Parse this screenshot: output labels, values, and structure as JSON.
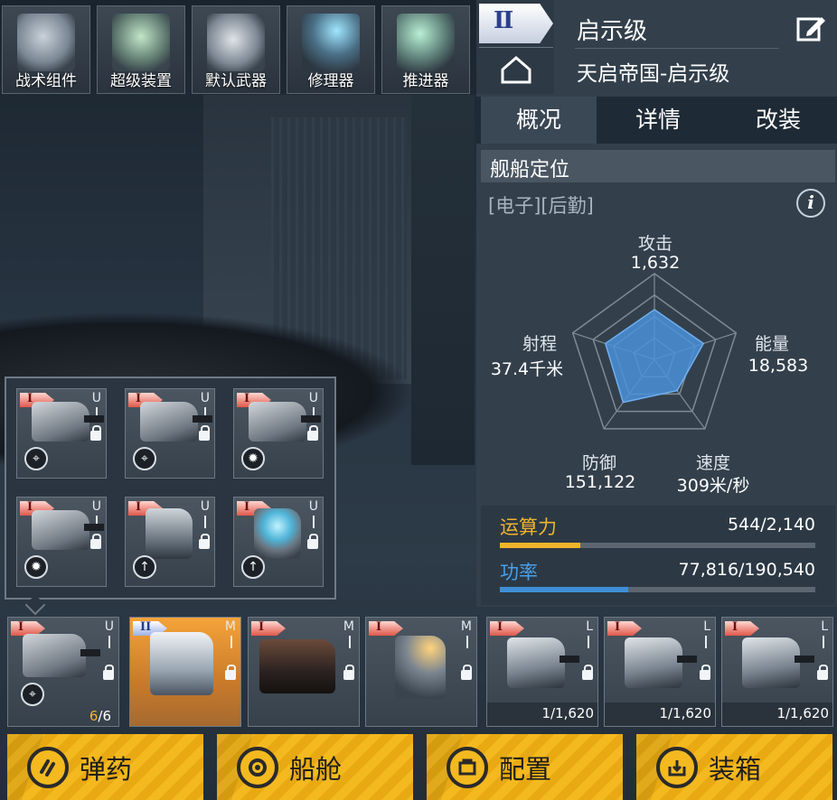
{
  "top_modules": [
    {
      "label": "战术组件",
      "icon": "tactical-module-icon"
    },
    {
      "label": "超级装置",
      "icon": "super-device-icon"
    },
    {
      "label": "默认武器",
      "icon": "default-weapon-icon"
    },
    {
      "label": "修理器",
      "icon": "repairer-icon"
    },
    {
      "label": "推进器",
      "icon": "thruster-icon"
    }
  ],
  "ship": {
    "tier": "II",
    "name": "启示级",
    "class_line": "天启帝国-启示级"
  },
  "tabs": [
    "概况",
    "详情",
    "改装"
  ],
  "active_tab": "概况",
  "positioning": {
    "title": "舰船定位",
    "roles": "[电子][后勤]"
  },
  "stats": {
    "attack_label": "攻击",
    "attack_value": "1,632",
    "energy_label": "能量",
    "energy_value": "18,583",
    "speed_label": "速度",
    "speed_value": "309米/秒",
    "defense_label": "防御",
    "defense_value": "151,122",
    "range_label": "射程",
    "range_value": "37.4千米",
    "radar_levels": {
      "attack": 0.58,
      "energy": 0.6,
      "speed": 0.45,
      "defense": 0.62,
      "range": 0.6
    }
  },
  "resources": {
    "cpu_label": "运算力",
    "cpu_value": "544/2,140",
    "cpu_fraction": 0.254,
    "power_label": "功率",
    "power_value": "77,816/190,540",
    "power_fraction": 0.408
  },
  "popup_slots": [
    {
      "tier": "I",
      "size": "U",
      "badge": "crosshair"
    },
    {
      "tier": "I",
      "size": "U",
      "badge": "crosshair"
    },
    {
      "tier": "I",
      "size": "U",
      "badge": "sun"
    },
    {
      "tier": "I",
      "size": "U",
      "badge": "sun"
    },
    {
      "tier": "I",
      "size": "U",
      "badge": "up-arrow"
    },
    {
      "tier": "I",
      "size": "U",
      "badge": "up-arrow"
    }
  ],
  "bottom_slots": [
    {
      "tier": "I",
      "size": "U",
      "count_a": "6",
      "count_b": "/6"
    },
    {
      "tier": "II",
      "size": "M"
    },
    {
      "tier": "I",
      "size": "M"
    },
    {
      "tier": "I",
      "size": "M"
    },
    {
      "tier": "I",
      "size": "L",
      "ammo": "1/1,620"
    },
    {
      "tier": "I",
      "size": "L",
      "ammo": "1/1,620"
    },
    {
      "tier": "I",
      "size": "L",
      "ammo": "1/1,620"
    }
  ],
  "actions": [
    {
      "label": "弹药",
      "icon": "ammo-icon"
    },
    {
      "label": "船舱",
      "icon": "cargo-icon"
    },
    {
      "label": "配置",
      "icon": "config-icon"
    },
    {
      "label": "装箱",
      "icon": "packing-icon"
    }
  ],
  "colors": {
    "cpu_bar": "#f0b42c",
    "power_bar": "#3f8fd6",
    "radar_fill": "#4a90d9",
    "action_yellow": "#f3b91f",
    "power_label": "#4a9fe8",
    "cpu_label": "#f0b42c"
  }
}
